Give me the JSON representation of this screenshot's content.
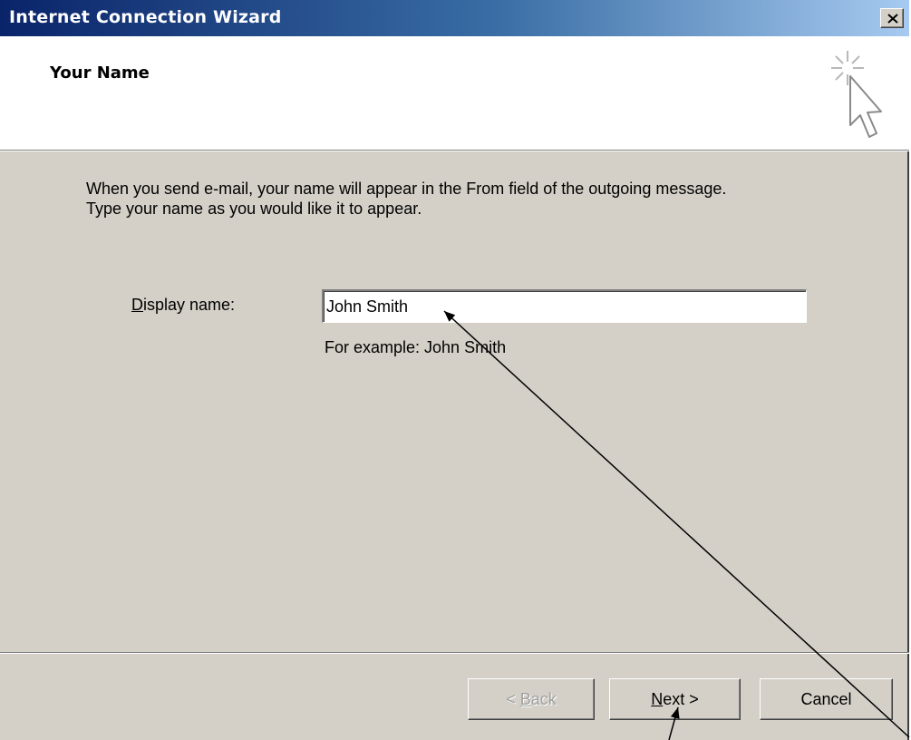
{
  "window": {
    "title": "Internet Connection Wizard",
    "close_label": "close"
  },
  "header": {
    "title": "Your Name",
    "icon": "wizard-cursor-sparkle-icon"
  },
  "body": {
    "description_line1": "When you send e-mail, your name will appear in the From field of the outgoing message.",
    "description_line2": "Type your name as you would like it to appear.",
    "display_name": {
      "label_mnemonic": "D",
      "label_rest": "isplay name:",
      "value": "John Smith",
      "hint": "For example: John Smith"
    }
  },
  "footer": {
    "back": {
      "mnemonic_prefix": "< ",
      "mnemonic": "B",
      "rest": "ack",
      "enabled": false
    },
    "next": {
      "mnemonic": "N",
      "rest": "ext >",
      "enabled": true
    },
    "cancel": {
      "label": "Cancel",
      "enabled": true
    }
  },
  "colors": {
    "titlebar_start": "#0a246a",
    "titlebar_end": "#a6caf0",
    "dialog_face": "#d4d0c8",
    "disabled_text": "#a0a0a0"
  }
}
